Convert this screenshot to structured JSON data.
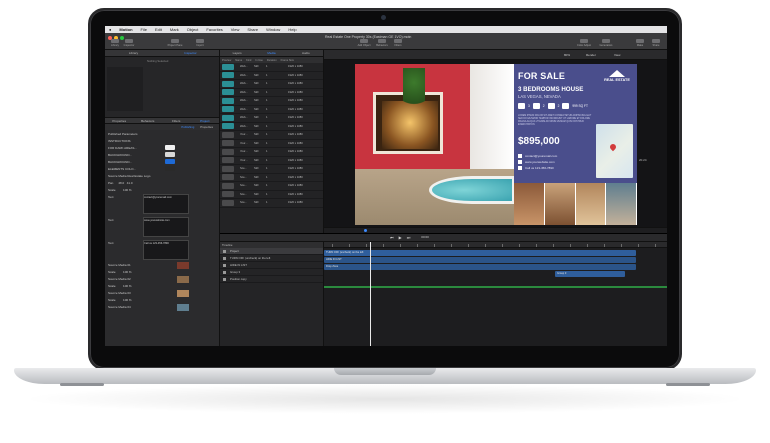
{
  "menubar": {
    "items": [
      "Motion",
      "File",
      "Edit",
      "Mark",
      "Object",
      "Favorites",
      "View",
      "Share",
      "Window",
      "Help"
    ]
  },
  "toolbar": {
    "title": "Real Estate One Property 30s (Eastman GE 1VO).motn",
    "buttons": [
      "Library",
      "Inspector",
      "Project Pane",
      "Import",
      "Add Object",
      "Behaviors",
      "Filters",
      "Color Adjust",
      "Generators",
      "Make",
      "Share"
    ]
  },
  "left_panel": {
    "tabs": [
      "Library",
      "Inspector"
    ],
    "active_tab": "Inspector",
    "preview_label": "Nothing Selected",
    "inspector_tabs": [
      "Properties",
      "Behaviors",
      "Filters",
      "Project"
    ],
    "inspector_subtabs": [
      "Publishing",
      "Properties"
    ],
    "section": "Published Parameters",
    "params": [
      {
        "label": "INSTRUCTIONS"
      },
      {
        "label": "FOR DARK AREAS...",
        "swatch": "#f1f1f1"
      },
      {
        "label": "BACKGROUND...",
        "swatch": "#d8d8d8"
      },
      {
        "label": "BACKGROUND...",
        "swatch": "#1e6ad6"
      },
      {
        "label": "ELEMENTS COLO...",
        "swatch": "#2a2a2a"
      },
      {
        "label": "Source Media",
        "value": "Real Estate Logo"
      }
    ],
    "pan_label": "Pan",
    "pan_values": [
      "48.0",
      "41.0"
    ],
    "scale_label": "Scale",
    "scale_value": "100 %",
    "text_label": "Text",
    "text_values": [
      "contact@youremail.com",
      "www.yourwebsite.com",
      "Call us 123-456-7890"
    ],
    "bottom_rows": [
      {
        "label": "Source Media",
        "num": "01"
      },
      {
        "label": "Scale",
        "value": "100 %"
      },
      {
        "label": "Source Media",
        "num": "02"
      },
      {
        "label": "Scale",
        "value": "100 %"
      },
      {
        "label": "Source Media",
        "num": "03"
      },
      {
        "label": "Scale",
        "value": "100 %"
      },
      {
        "label": "Source Media",
        "num": "04"
      }
    ]
  },
  "layers_panel": {
    "tabs": [
      "Layers",
      "Media",
      "Audio"
    ],
    "active_tab": "Media",
    "columns": [
      "Preview",
      "Name",
      "Kind",
      "In Use",
      "Duration",
      "Frame Size"
    ],
    "rows": [
      {
        "name": "Web...",
        "kind": "Still",
        "use": "1",
        "size": "1920 x 1080"
      },
      {
        "name": "Web...",
        "kind": "Still",
        "use": "1",
        "size": "1920 x 1080"
      },
      {
        "name": "Web...",
        "kind": "Still",
        "use": "1",
        "size": "1920 x 1080"
      },
      {
        "name": "Web...",
        "kind": "Still",
        "use": "1",
        "size": "1920 x 1080"
      },
      {
        "name": "Web...",
        "kind": "Still",
        "use": "1",
        "size": "1920 x 1080"
      },
      {
        "name": "Web...",
        "kind": "Still",
        "use": "1",
        "size": "1920 x 1080"
      },
      {
        "name": "Web...",
        "kind": "Still",
        "use": "1",
        "size": "1920 x 1080"
      },
      {
        "name": "Web...",
        "kind": "Still",
        "use": "1",
        "size": "1920 x 1080"
      },
      {
        "name": "Your...",
        "kind": "Still",
        "use": "1",
        "size": "1920 x 1080"
      },
      {
        "name": "Your...",
        "kind": "Still",
        "use": "1",
        "size": "1920 x 1080"
      },
      {
        "name": "Your...",
        "kind": "Still",
        "use": "1",
        "size": "1920 x 1080"
      },
      {
        "name": "Your...",
        "kind": "Still",
        "use": "1",
        "size": "1920 x 1080"
      },
      {
        "name": "Sce...",
        "kind": "Still",
        "use": "1",
        "size": "1920 x 1080"
      },
      {
        "name": "Sce...",
        "kind": "Still",
        "use": "1",
        "size": "1920 x 1080"
      },
      {
        "name": "Sce...",
        "kind": "Still",
        "use": "1",
        "size": "1920 x 1080"
      },
      {
        "name": "Sce...",
        "kind": "Still",
        "use": "1",
        "size": "1920 x 1080"
      },
      {
        "name": "Sce...",
        "kind": "Still",
        "use": "1",
        "size": "1920 x 1080"
      }
    ]
  },
  "canvas": {
    "zoom": "80%",
    "render": "Render",
    "view": "View",
    "ad": {
      "for_sale": "FOR SALE",
      "logo_line1": "REAL ESTATE",
      "bedrooms": "3 BEDROOMS HOUSE",
      "city": "LAS VEGAS, NEVADA",
      "specs": [
        "3",
        "2",
        "2",
        "999 SQ FT"
      ],
      "lorem": "LOREM IPSUM DOLOR SIT AMET CONSECTETUR ADIPISCING ELIT SED DO EIUSMOD TEMPOR INCIDIDUNT UT LABORE ET DOLORE MAGNA ALIQUA UT ENIM AD MINIM VENIAM QUIS NOSTRUD EXERCITATION",
      "price": "$895,000",
      "email": "contact@youremail.com",
      "web": "www.yourwebsite.com",
      "phone": "Call us 123-456-7890"
    },
    "side_value": "20.24"
  },
  "timeline": {
    "title": "Timeline",
    "timecode": "00:00",
    "rows": [
      {
        "label": "Project"
      },
      {
        "label": "TURN OFF (uncheck) on the left"
      },
      {
        "label": "HIDE IN LIST"
      },
      {
        "label": "Group 3"
      },
      {
        "label": "Position copy"
      }
    ],
    "bars": [
      {
        "label": "TURN OFF (uncheck) on the left"
      },
      {
        "label": "HIDE IN LIST"
      },
      {
        "label": "Drop Zone"
      },
      {
        "label": "Group 3"
      }
    ]
  },
  "colors": {
    "accent": "#3d8bff",
    "ad_purple": "#4a4e8c",
    "teal": "#2b8f95"
  }
}
